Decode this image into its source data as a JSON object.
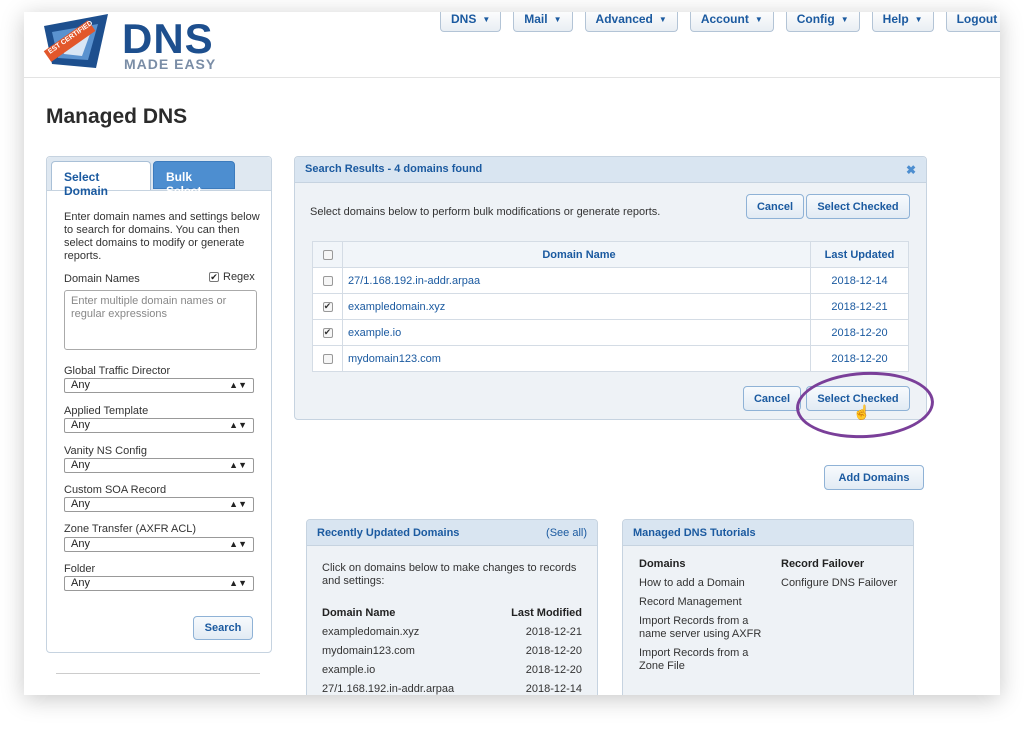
{
  "brand": {
    "name": "DNS",
    "sub": "MADE EASY",
    "badge": "EST CERTIFIED"
  },
  "nav": [
    {
      "label": "DNS",
      "has_caret": true
    },
    {
      "label": "Mail",
      "has_caret": true
    },
    {
      "label": "Advanced",
      "has_caret": true
    },
    {
      "label": "Account",
      "has_caret": true
    },
    {
      "label": "Config",
      "has_caret": true
    },
    {
      "label": "Help",
      "has_caret": true
    },
    {
      "label": "Logout",
      "has_caret": false
    }
  ],
  "page_title": "Managed DNS",
  "sidebar": {
    "tabs": [
      "Select Domain",
      "Bulk Select"
    ],
    "description": "Enter domain names and settings below to search for domains. You can then select domains to modify or generate reports.",
    "domain_names_label": "Domain Names",
    "regex_label": "Regex",
    "regex_checked": true,
    "textarea_placeholder": "Enter multiple domain names or regular expressions",
    "filters": [
      {
        "label": "Global Traffic Director",
        "value": "Any"
      },
      {
        "label": "Applied Template",
        "value": "Any"
      },
      {
        "label": "Vanity NS Config",
        "value": "Any"
      },
      {
        "label": "Custom SOA Record",
        "value": "Any"
      },
      {
        "label": "Zone Transfer (AXFR ACL)",
        "value": "Any"
      },
      {
        "label": "Folder",
        "value": "Any"
      }
    ],
    "search_label": "Search"
  },
  "results": {
    "title": "Search Results - 4 domains found",
    "close_glyph": "✖",
    "description": "Select domains below to perform bulk modifications or generate reports.",
    "cancel_label": "Cancel",
    "select_checked_label": "Select Checked",
    "columns": [
      "Domain Name",
      "Last Updated"
    ],
    "rows": [
      {
        "name": "27/1.168.192.in-addr.arpaa",
        "date": "2018-12-14",
        "checked": false
      },
      {
        "name": "exampledomain.xyz",
        "date": "2018-12-21",
        "checked": true
      },
      {
        "name": "example.io",
        "date": "2018-12-20",
        "checked": true
      },
      {
        "name": "mydomain123.com",
        "date": "2018-12-20",
        "checked": false
      }
    ]
  },
  "add_domains_label": "Add Domains",
  "recent": {
    "title": "Recently Updated Domains",
    "see_all": "(See all)",
    "description": "Click on domains below to make changes to records and settings:",
    "col_name": "Domain Name",
    "col_modified": "Last Modified",
    "rows": [
      {
        "name": "exampledomain.xyz",
        "date": "2018-12-21"
      },
      {
        "name": "mydomain123.com",
        "date": "2018-12-20"
      },
      {
        "name": "example.io",
        "date": "2018-12-20"
      },
      {
        "name": "27/1.168.192.in-addr.arpaa",
        "date": "2018-12-14"
      }
    ]
  },
  "tutorials": {
    "title": "Managed DNS Tutorials",
    "col1_heading": "Domains",
    "col1_items": [
      "How to add a Domain",
      "Record Management",
      "Import Records from a name server using AXFR",
      "Import Records from a Zone File"
    ],
    "col2_heading": "Record Failover",
    "col2_items": [
      "Configure DNS Failover"
    ]
  },
  "colors": {
    "accent": "#1b5aa0",
    "tab_active": "#4d8ed0",
    "highlight_ring": "#7a3f99",
    "logo_blue": "#1d4f8e",
    "badge_orange": "#e2572b"
  }
}
